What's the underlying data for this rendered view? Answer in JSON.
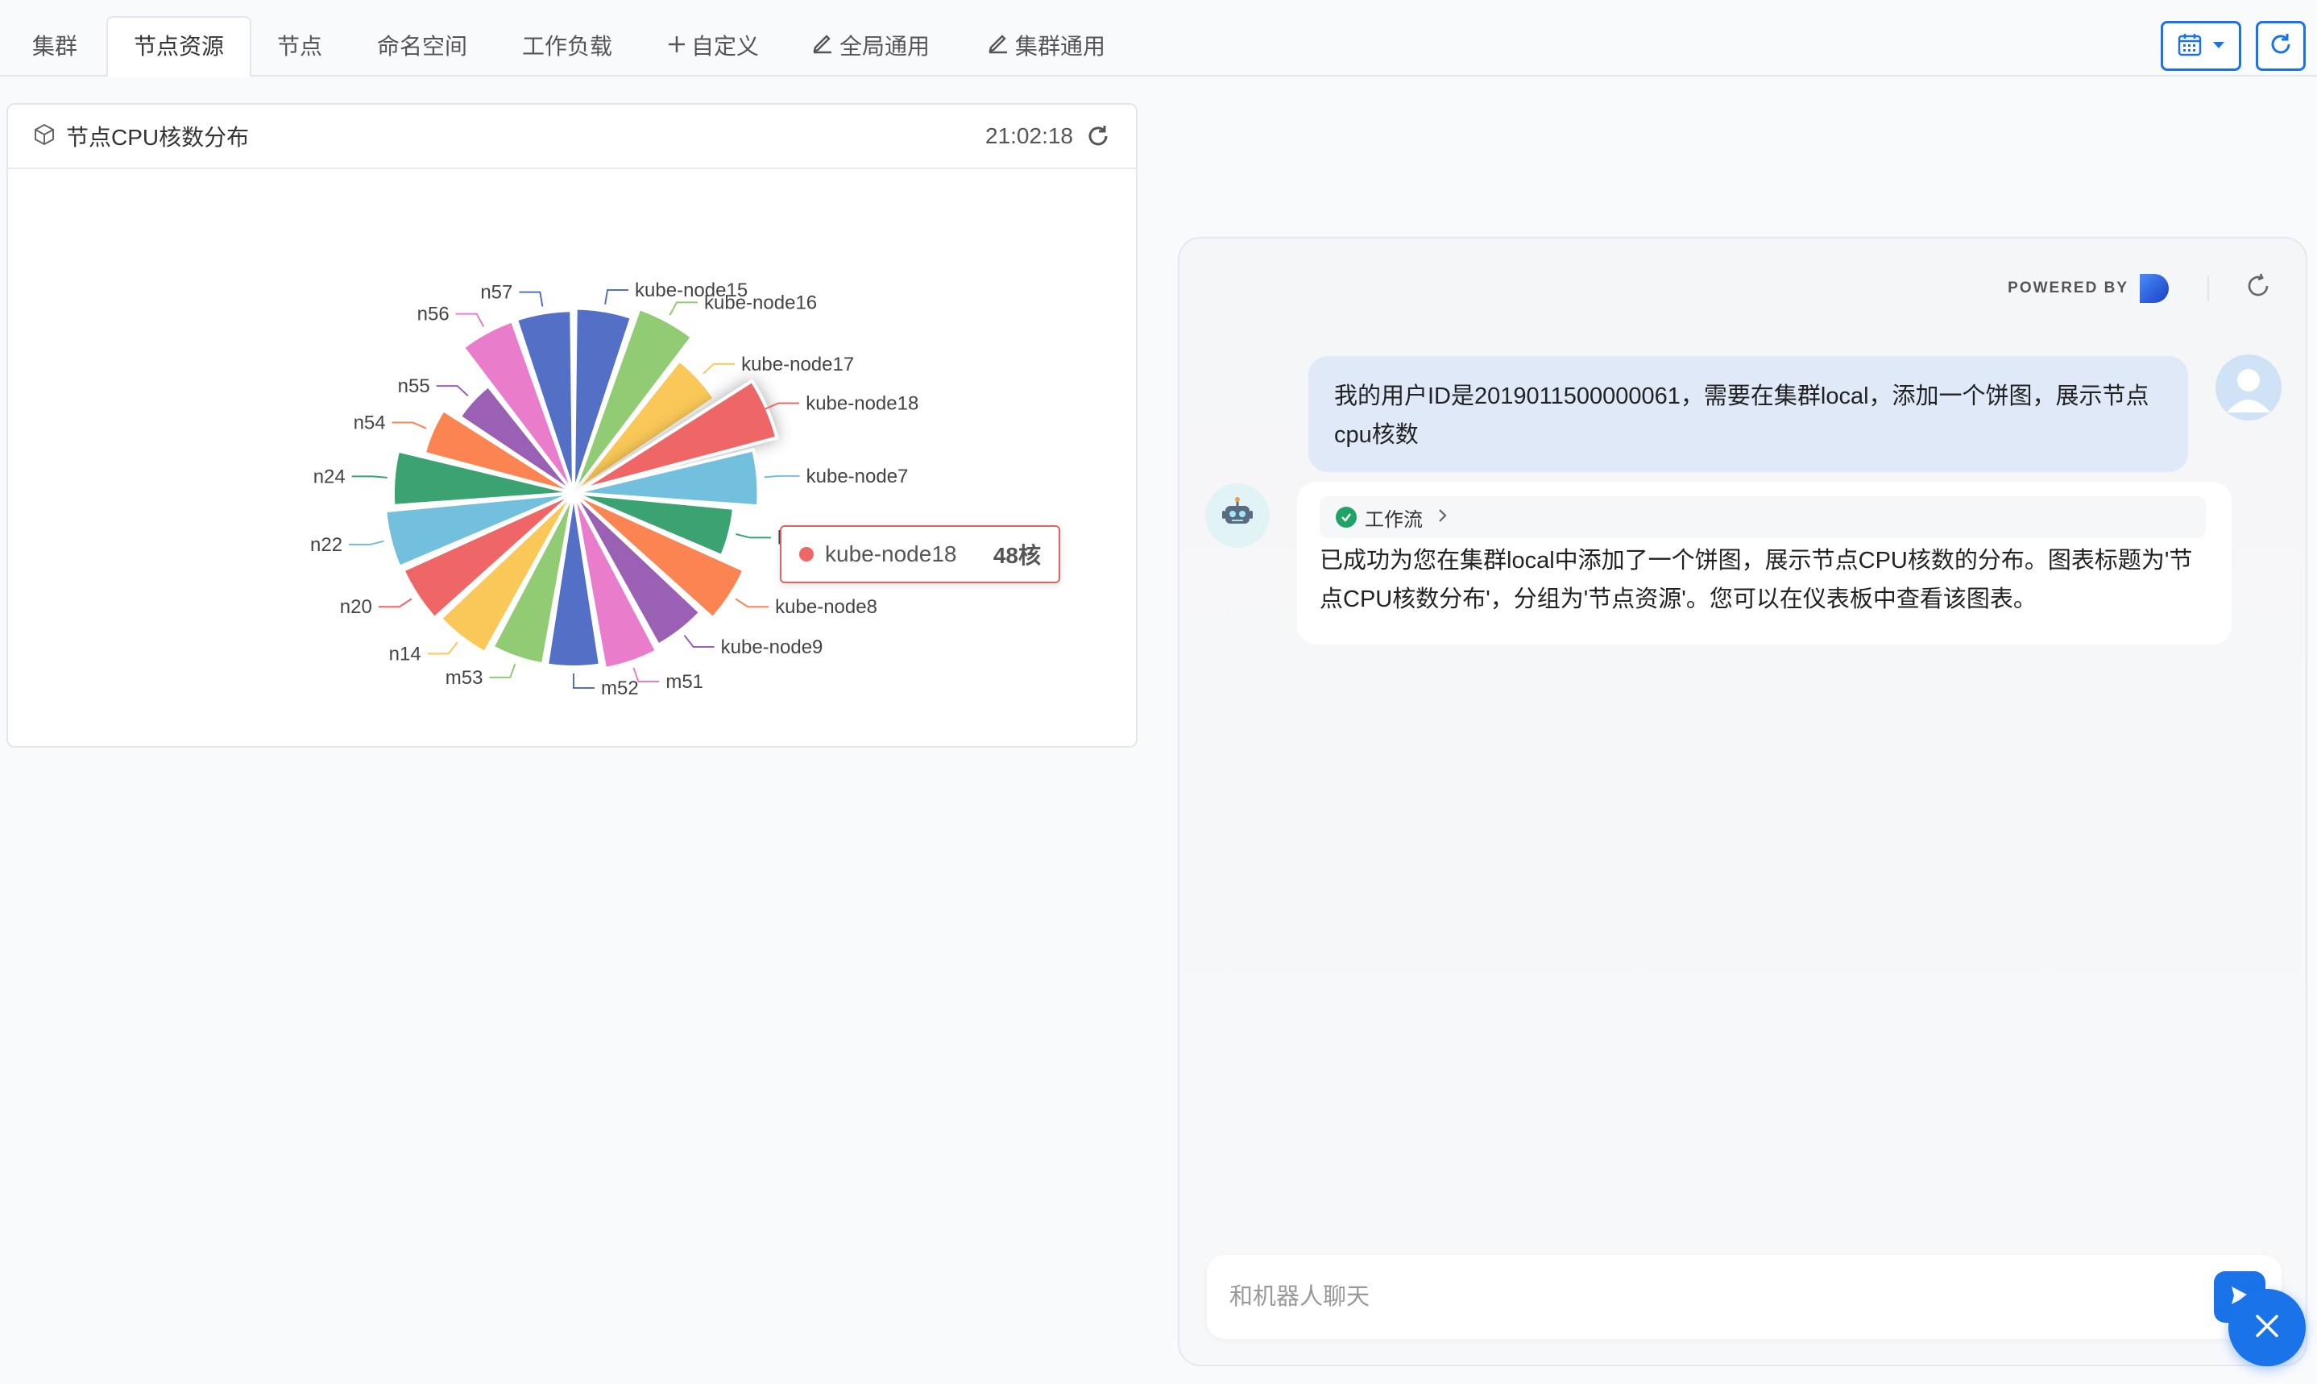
{
  "tabs": [
    {
      "label": "集群",
      "icon": ""
    },
    {
      "label": "节点资源",
      "icon": "",
      "active": true
    },
    {
      "label": "节点",
      "icon": ""
    },
    {
      "label": "命名空间",
      "icon": ""
    },
    {
      "label": "工作负载",
      "icon": ""
    },
    {
      "label": "自定义",
      "icon": "plus-icon"
    },
    {
      "label": "全局通用",
      "icon": "edit-icon"
    },
    {
      "label": "集群通用",
      "icon": "edit-icon"
    }
  ],
  "toolbar": {
    "date_icon": "calendar-icon",
    "refresh_icon": "refresh-icon",
    "accent": "#1a73e8"
  },
  "card": {
    "title": "节点CPU核数分布",
    "time": "21:02:18",
    "icon": "cube-icon"
  },
  "chart_data": {
    "type": "pie",
    "rose": true,
    "labels": [
      "kube-node15",
      "kube-node16",
      "kube-node17",
      "kube-node18",
      "kube-node7",
      "kube-node76",
      "kube-node8",
      "kube-node9",
      "m51",
      "m52",
      "m53",
      "n14",
      "n20",
      "n22",
      "n24",
      "n54",
      "n55",
      "n56",
      "n57"
    ],
    "colors": [
      "#5470c6",
      "#91cc75",
      "#fac858",
      "#ee6666",
      "#73c0de",
      "#3ba272",
      "#fc8452",
      "#9a60b4",
      "#ea7ccc",
      "#5470c6",
      "#91cc75",
      "#fac858",
      "#ee6666",
      "#73c0de",
      "#3ba272",
      "#fc8452",
      "#9a60b4",
      "#ea7ccc",
      "#5470c6"
    ],
    "relative_values": [
      0.85,
      0.9,
      0.78,
      0.88,
      0.85,
      0.74,
      0.86,
      0.8,
      0.82,
      0.8,
      0.8,
      0.84,
      0.86,
      0.87,
      0.83,
      0.71,
      0.63,
      0.84,
      0.84
    ],
    "tooltip": {
      "label": "kube-node18",
      "value": "48核"
    }
  },
  "chat": {
    "powered_by": "POWERED BY",
    "user_message": "我的用户ID是2019011500000061，需要在集群local，添加一个饼图，展示节点cpu核数",
    "workflow_label": "工作流",
    "bot_message": "已成功为您在集群local中添加了一个饼图，展示节点CPU核数的分布。图表标题为'节点CPU核数分布'，分组为'节点资源'。您可以在仪表板中查看该图表。",
    "input_placeholder": "和机器人聊天"
  }
}
